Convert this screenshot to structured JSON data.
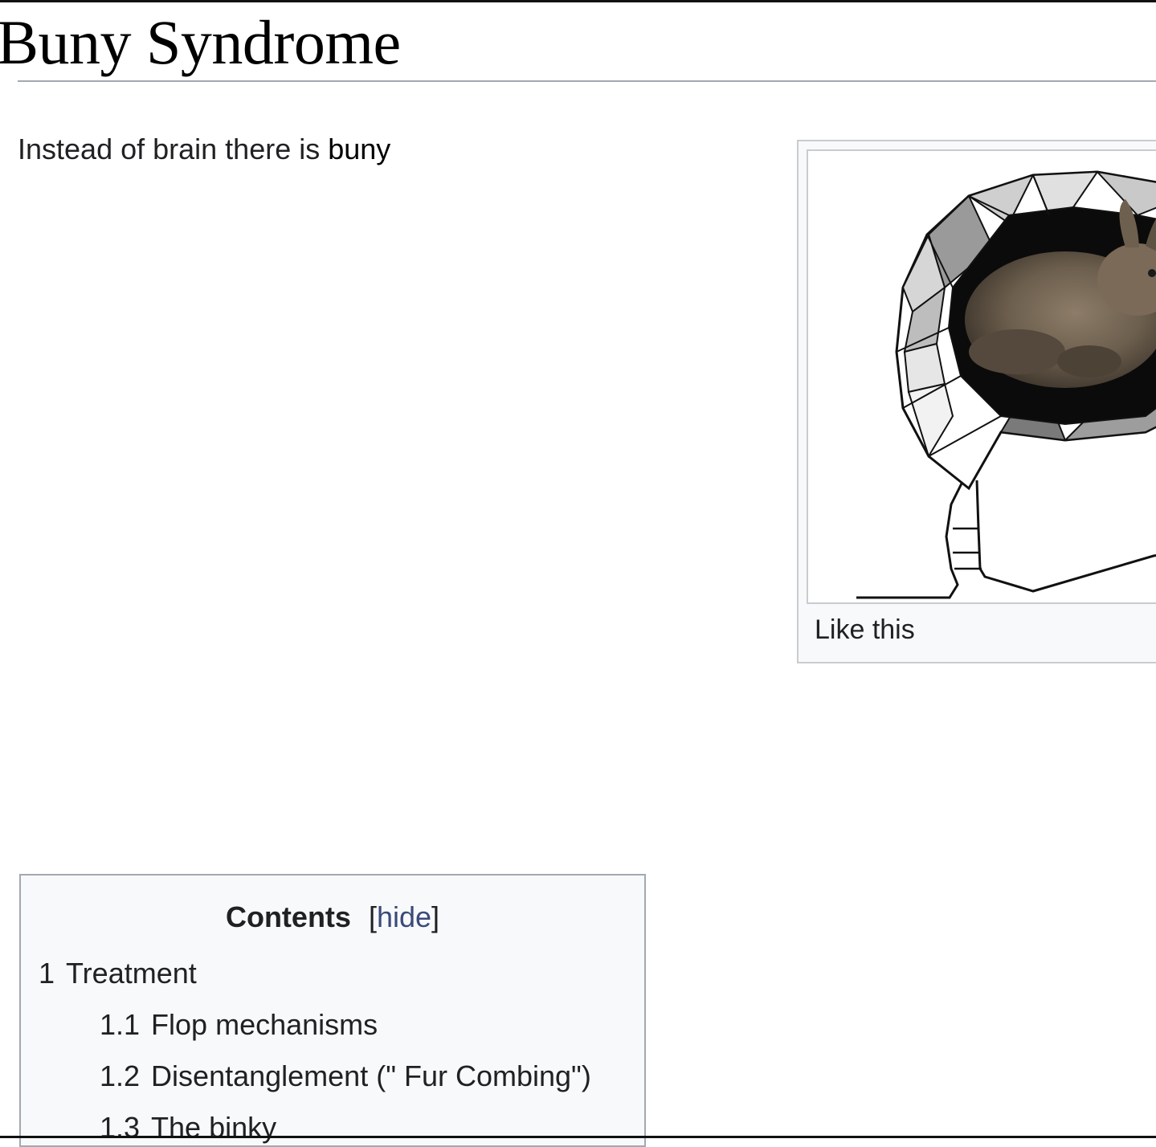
{
  "article": {
    "title": "Buny Syndrome",
    "lead_prefix": "Instead of brain there is ",
    "lead_bold": "buny"
  },
  "infobox": {
    "image_alt": "rabbit-in-head illustration",
    "caption": "Like this"
  },
  "toc": {
    "title": "Contents",
    "hide_open": "[",
    "hide_label": "hide",
    "hide_close": "]",
    "items": [
      {
        "number": "1",
        "text": "Treatment"
      },
      {
        "number": "1.1",
        "text": "Flop mechanisms"
      },
      {
        "number": "1.2",
        "text": "Disentanglement (\" Fur  Combing\")"
      },
      {
        "number": "1.3",
        "text": "The binky"
      }
    ]
  },
  "colors": {
    "link": "#3a4a7a",
    "border": "#a2a9b1",
    "toc_background": "#f8f9fa"
  }
}
